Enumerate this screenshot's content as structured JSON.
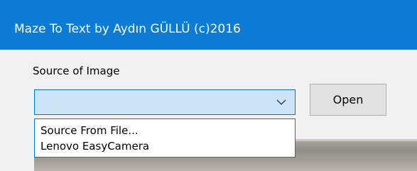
{
  "window": {
    "title": "Maze To Text by Aydın GÜLLÜ (c)2016"
  },
  "source": {
    "label": "Source of Image",
    "selected_value": "",
    "options": [
      "Source From File...",
      "Lenovo EasyCamera"
    ]
  },
  "buttons": {
    "open_label": "Open"
  },
  "colors": {
    "titlebar": "#0c7bd6",
    "combo_focus_fill": "#cce4f7",
    "focus_border": "#0078d7"
  },
  "icons": {
    "combo_arrow": "chevron-down-icon"
  }
}
